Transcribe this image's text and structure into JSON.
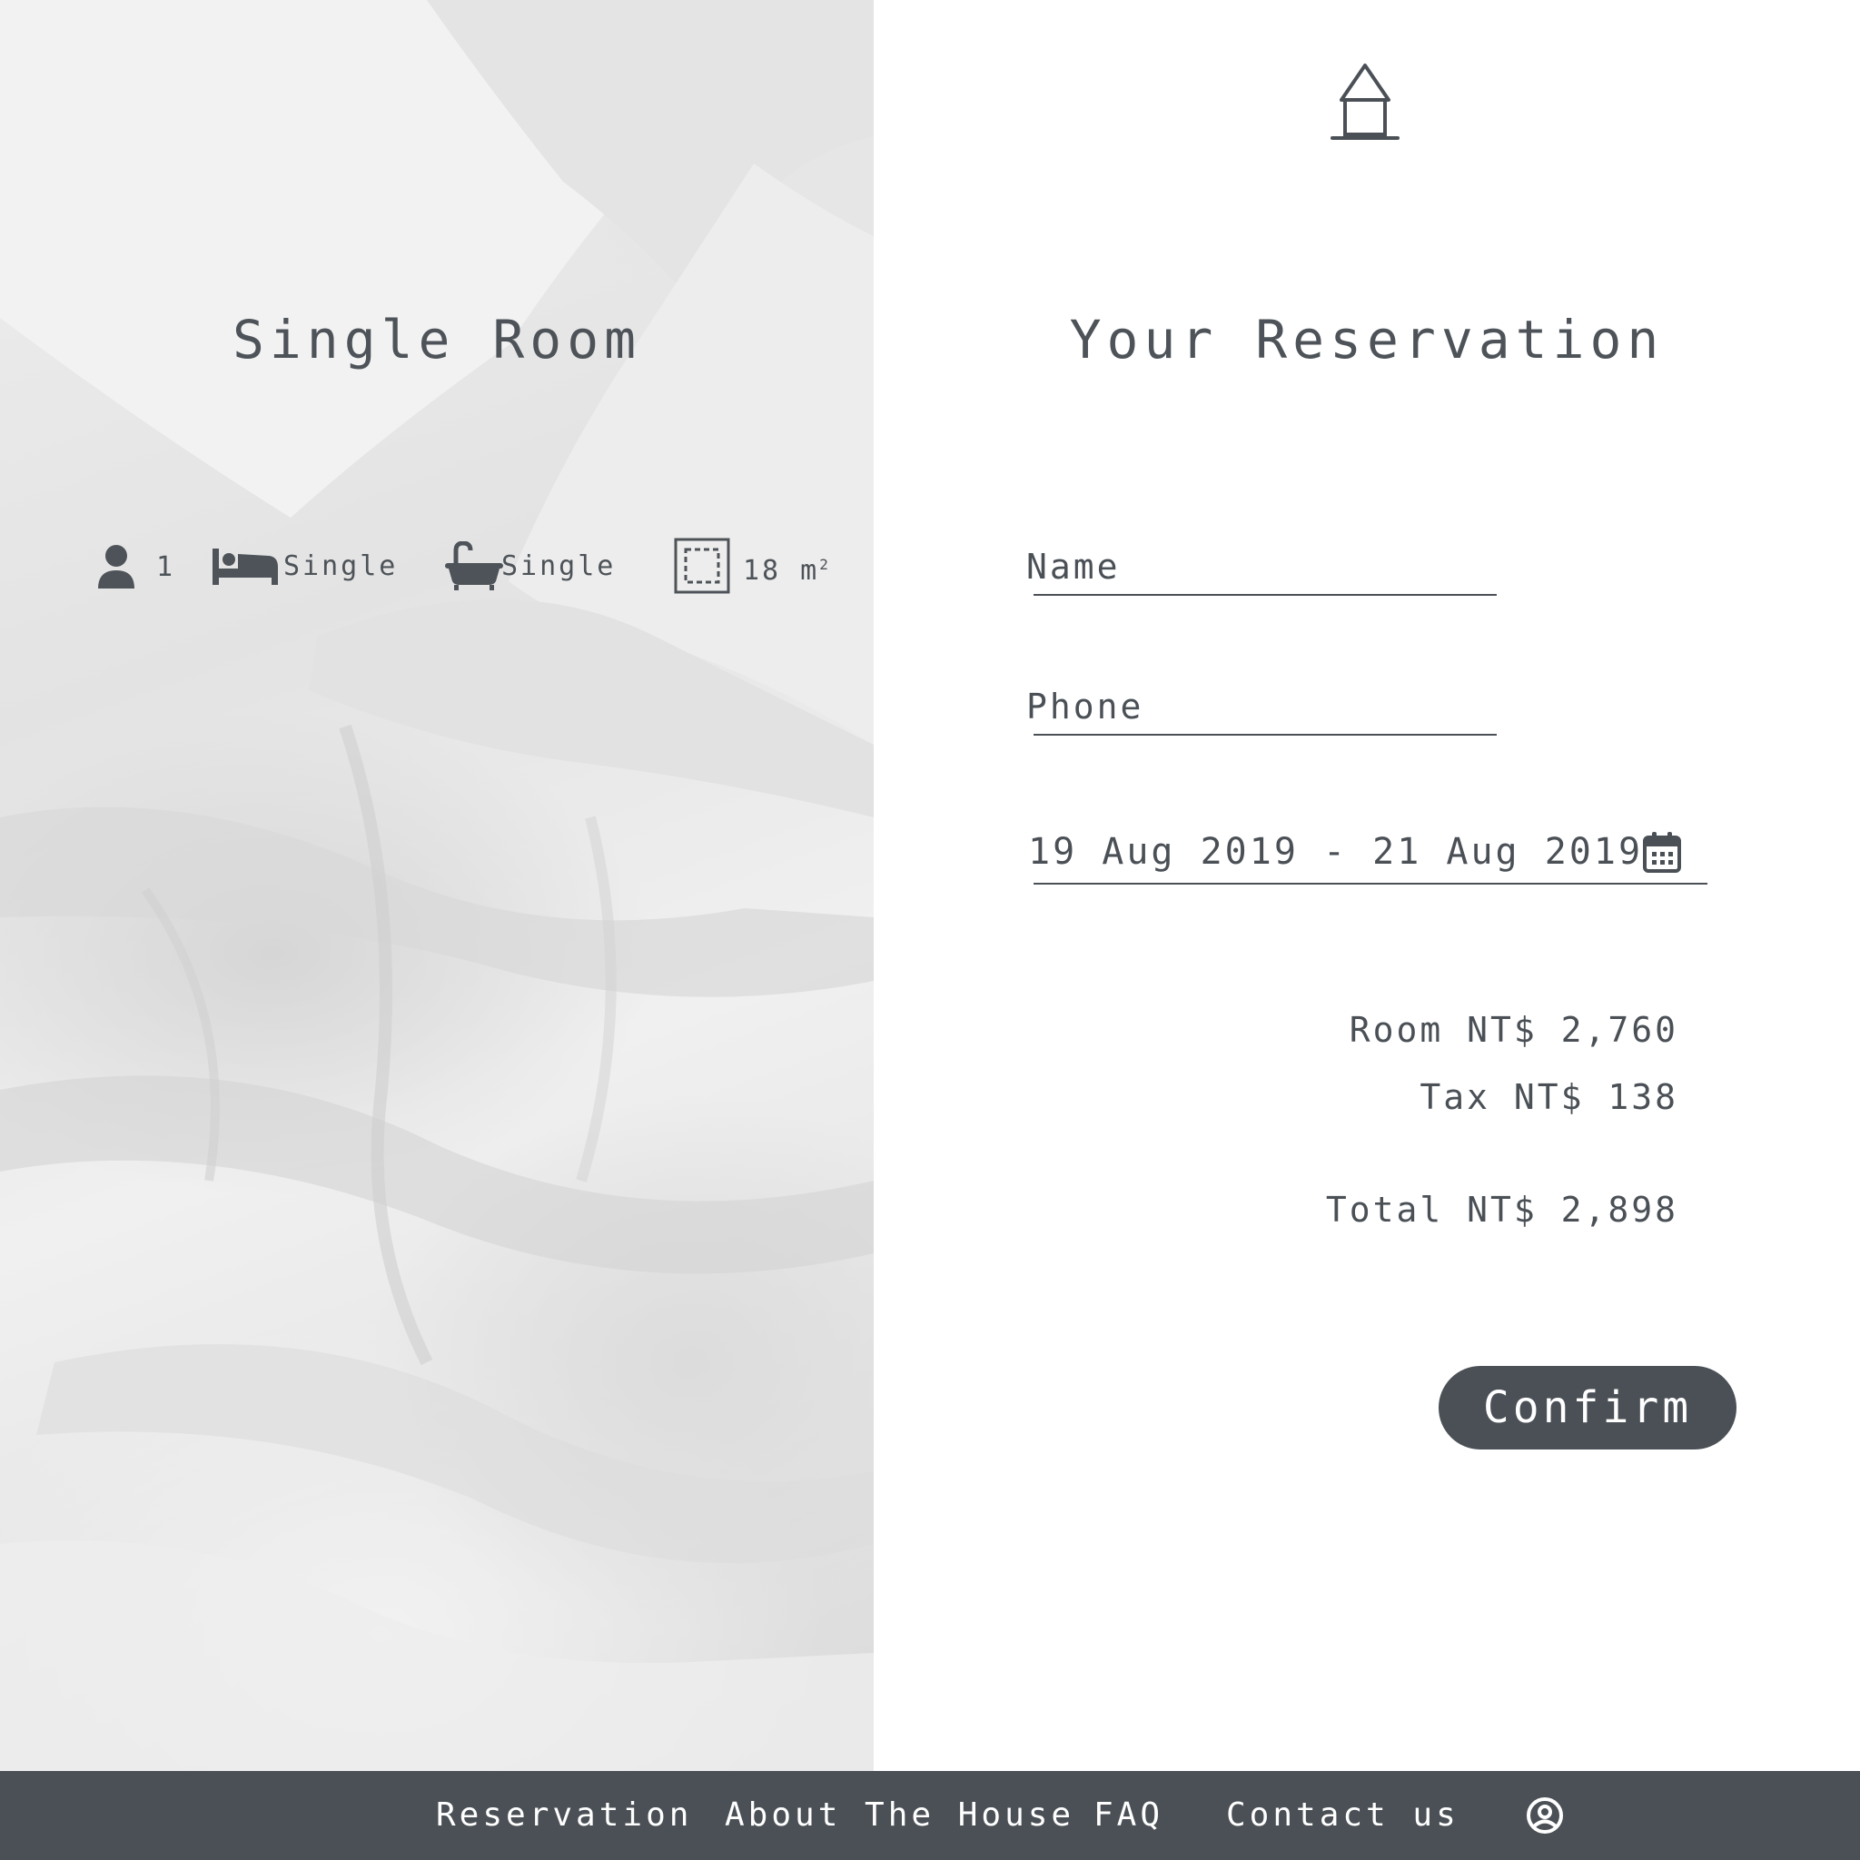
{
  "room": {
    "title": "Single Room",
    "features": {
      "guests": "1",
      "bed": "Single",
      "bath": "Single",
      "area": "18 m",
      "area_sup": "2"
    }
  },
  "header": {
    "logo_icon": "house-icon"
  },
  "reservation": {
    "title": "Your Reservation",
    "name_placeholder": "Name",
    "phone_placeholder": "Phone",
    "dates": "19 Aug 2019 - 21 Aug 2019",
    "calendar_icon": "calendar-icon",
    "room_price": "Room NT$ 2,760",
    "tax": "Tax NT$ 138",
    "total": "Total NT$ 2,898",
    "confirm_label": "Confirm"
  },
  "footer": {
    "nav": [
      "Reservation",
      "About The House",
      "FAQ",
      "Contact us"
    ],
    "user_icon": "user-circle-icon"
  },
  "colors": {
    "primary": "#4a5056",
    "background": "#ffffff",
    "button_text": "#ffffff"
  }
}
